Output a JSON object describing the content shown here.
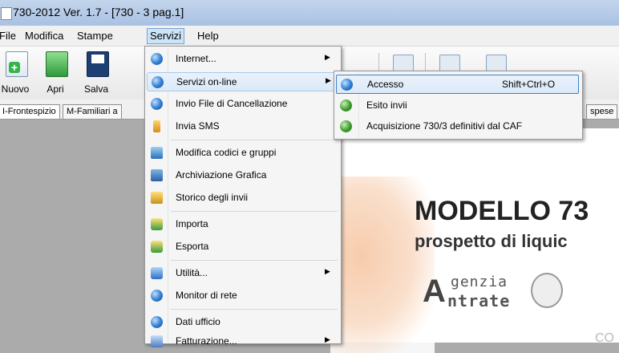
{
  "window": {
    "title": "730-2012 Ver. 1.7 - [730 - 3 pag.1]"
  },
  "menubar": {
    "items": [
      {
        "label": "File"
      },
      {
        "label": "Modifica"
      },
      {
        "label": "Stampe"
      },
      {
        "label": "Servizi"
      },
      {
        "label": "Help"
      }
    ]
  },
  "toolbar": {
    "buttons": [
      {
        "label": "Nuovo",
        "icon": "new-document-icon"
      },
      {
        "label": "Apri",
        "icon": "open-folder-icon"
      },
      {
        "label": "Salva",
        "icon": "save-disk-icon"
      }
    ]
  },
  "tabs": [
    {
      "label": "I-Frontespizio"
    },
    {
      "label": "M-Familiari a"
    },
    {
      "label": "spese"
    }
  ],
  "servizi_menu": {
    "items": [
      {
        "label": "Internet...",
        "icon": "globe-icon",
        "submenu": true
      },
      {
        "label": "Servizi on-line",
        "icon": "globe-icon",
        "submenu": true
      },
      {
        "label": "Invio File di Cancellazione",
        "icon": "globe-send-icon",
        "submenu": false
      },
      {
        "label": "Invia SMS",
        "icon": "phone-icon",
        "submenu": false
      },
      {
        "label": "Modifica codici e gruppi",
        "icon": "edit-codes-icon",
        "submenu": false
      },
      {
        "label": "Archiviazione Grafica",
        "icon": "archive-icon",
        "submenu": false
      },
      {
        "label": "Storico degli invii",
        "icon": "history-icon",
        "submenu": false
      },
      {
        "label": "Importa",
        "icon": "import-icon",
        "submenu": false
      },
      {
        "label": "Esporta",
        "icon": "export-icon",
        "submenu": false
      },
      {
        "label": "Utilità...",
        "icon": "utility-icon",
        "submenu": true
      },
      {
        "label": "Monitor di rete",
        "icon": "network-monitor-icon",
        "submenu": false
      },
      {
        "label": "Dati ufficio",
        "icon": "office-data-icon",
        "submenu": false
      },
      {
        "label": "Fatturazione...",
        "icon": "billing-icon",
        "submenu": true
      }
    ]
  },
  "servizi_online_submenu": {
    "items": [
      {
        "label": "Accesso",
        "shortcut": "Shift+Ctrl+O",
        "icon": "globe-icon"
      },
      {
        "label": "Esito invii",
        "shortcut": "",
        "icon": "globe-green-icon"
      },
      {
        "label": "Acquisizione 730/3 definitivi dal CAF",
        "shortcut": "",
        "icon": "globe-green-icon"
      }
    ]
  },
  "document": {
    "title": "MODELLO 73",
    "subtitle": "prospetto di liquic",
    "logo_text_line1": "genzia",
    "logo_text_line2": "ntrate",
    "footer_text": "CO"
  },
  "colors": {
    "title_bar": "#b7cce8",
    "menu_highlight": "#dbe9f8",
    "submenu_highlight_border": "#3e7fc9",
    "workspace": "#ababab"
  }
}
